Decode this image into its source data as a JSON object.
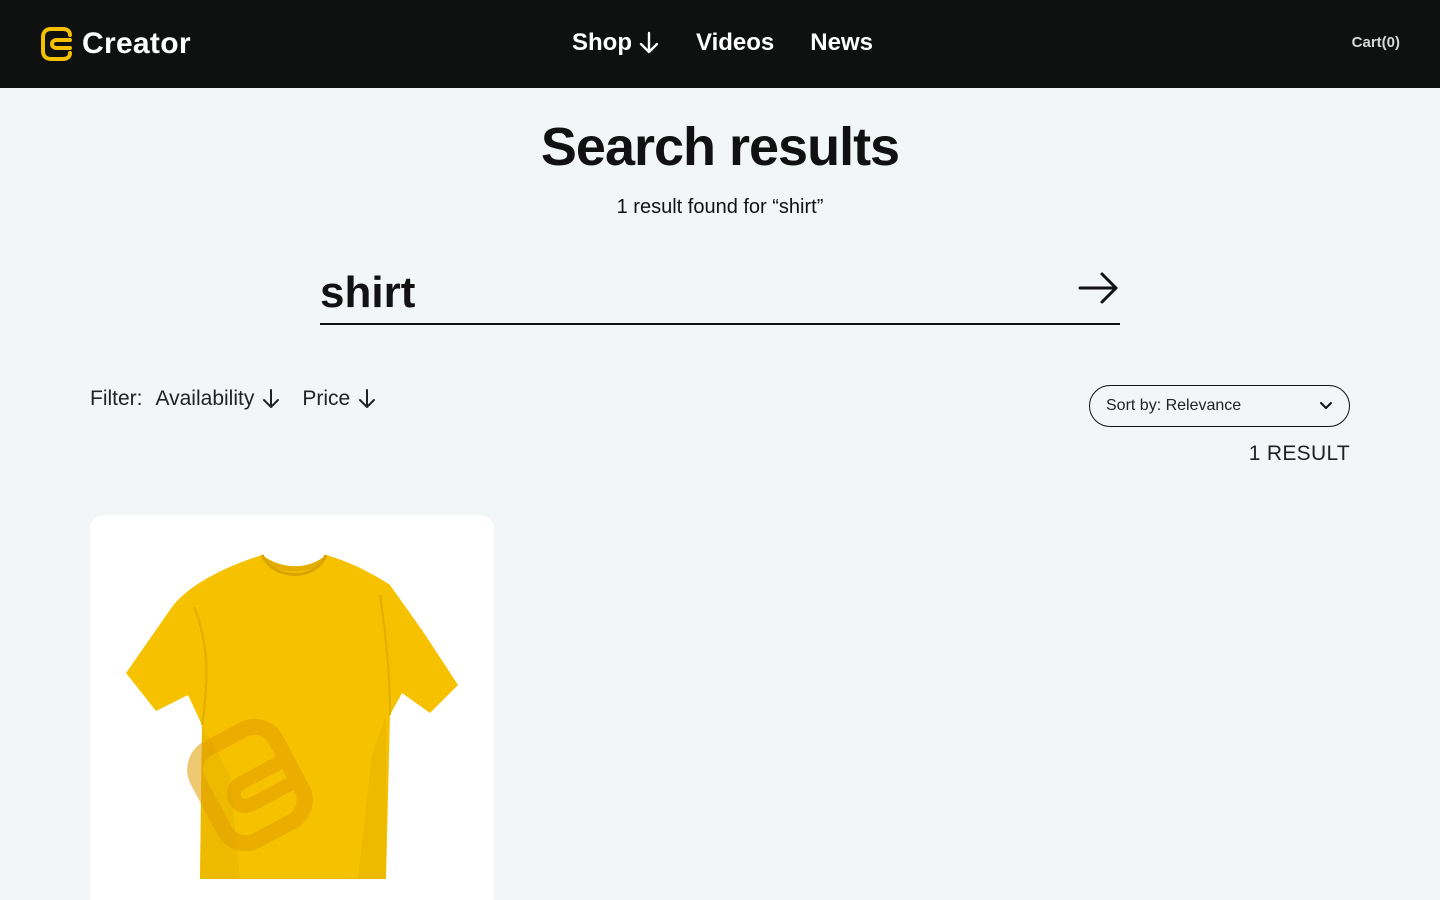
{
  "header": {
    "brand": "Creator",
    "nav": [
      {
        "label": "Shop",
        "has_dropdown": true
      },
      {
        "label": "Videos",
        "has_dropdown": false
      },
      {
        "label": "News",
        "has_dropdown": false
      }
    ],
    "cart_label": "Cart(0)"
  },
  "page": {
    "title": "Search results",
    "summary": "1 result found for “shirt”"
  },
  "search": {
    "value": "shirt",
    "submit_icon": "arrow-right-icon"
  },
  "filters": {
    "label": "Filter:",
    "options": [
      "Availability",
      "Price"
    ]
  },
  "sort": {
    "label": "Sort by: Relevance",
    "icon": "chevron-down-icon"
  },
  "results": {
    "count_label": "1 RESULT",
    "items": [
      {
        "image": "yellow-tshirt",
        "color": "#f5c000"
      }
    ]
  },
  "colors": {
    "header_bg": "#0f1110",
    "page_bg": "#f2f6f7",
    "accent": "#f5c000"
  }
}
